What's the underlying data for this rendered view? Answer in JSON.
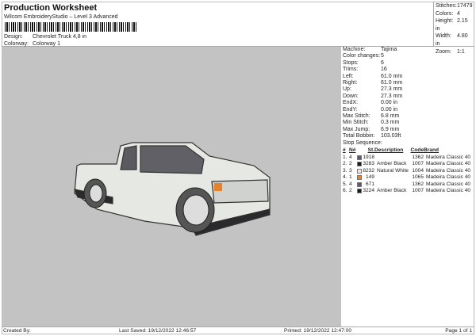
{
  "header": {
    "title": "Production Worksheet",
    "subtitle": "Wilcom EmbroideryStudio – Level 3 Advanced",
    "design_label": "Design:",
    "design_value": "Chevrolet Truck 4,8 in",
    "colorway_label": "Colorway:",
    "colorway_value": "Colorway 1"
  },
  "stats": [
    {
      "k": "Stitches:",
      "v": "17479"
    },
    {
      "k": "Colors:",
      "v": "4"
    },
    {
      "k": "Height:",
      "v": "2.15 in"
    },
    {
      "k": "Width:",
      "v": "4.80 in"
    },
    {
      "k": "Zoom:",
      "v": "1:1"
    }
  ],
  "details": [
    {
      "k": "Machine:",
      "v": "Tajima"
    },
    {
      "k": "Color changes:",
      "v": "5"
    },
    {
      "k": "Stops:",
      "v": "6"
    },
    {
      "k": "Trims:",
      "v": "16"
    },
    {
      "k": "Left:",
      "v": "61.0 mm"
    },
    {
      "k": "Right:",
      "v": "61.0 mm"
    },
    {
      "k": "Up:",
      "v": "27.3 mm"
    },
    {
      "k": "Down:",
      "v": "27.3 mm"
    },
    {
      "k": "EndX:",
      "v": "0.00 in"
    },
    {
      "k": "EndY:",
      "v": "0.00 in"
    },
    {
      "k": "Max Stitch:",
      "v": "6.8 mm"
    },
    {
      "k": "Min Stitch:",
      "v": "0.3 mm"
    },
    {
      "k": "Max Jump:",
      "v": "6.9 mm"
    },
    {
      "k": "Total Bobbin:",
      "v": "103.03ft"
    }
  ],
  "stop_sequence": {
    "label": "Stop Sequence:",
    "columns": [
      "#",
      "N#",
      "St.",
      "Description",
      "Code",
      "Brand"
    ],
    "rows": [
      {
        "n": "1.",
        "needle": "4",
        "color": "#5b5a70",
        "st": "1918",
        "desc": "",
        "code": "1362",
        "brand": "Madeira Classic 40"
      },
      {
        "n": "2.",
        "needle": "2",
        "color": "#1a1a1a",
        "st": "3283",
        "desc": "Amber Black",
        "code": "1007",
        "brand": "Madeira Classic 40"
      },
      {
        "n": "3.",
        "needle": "3",
        "color": "#ecebec",
        "st": "8232",
        "desc": "Natural White",
        "code": "1004",
        "brand": "Madeira Classic 40"
      },
      {
        "n": "4.",
        "needle": "1",
        "color": "#e8822a",
        "st": "149",
        "desc": "",
        "code": "1065",
        "brand": "Madeira Classic 40"
      },
      {
        "n": "5.",
        "needle": "4",
        "color": "#5b5a70",
        "st": "671",
        "desc": "",
        "code": "1362",
        "brand": "Madeira Classic 40"
      },
      {
        "n": "6.",
        "needle": "2",
        "color": "#1a1a1a",
        "st": "3224",
        "desc": "Amber Black",
        "code": "1007",
        "brand": "Madeira Classic 40"
      }
    ]
  },
  "footer": {
    "created": "Created By:",
    "saved": "Last Saved: 19/12/2022 12:46:57",
    "printed": "Printed: 19/12/2022 12:47:00",
    "page": "Page 1 of 1"
  },
  "colors": {
    "background": "#c3c3c3"
  }
}
